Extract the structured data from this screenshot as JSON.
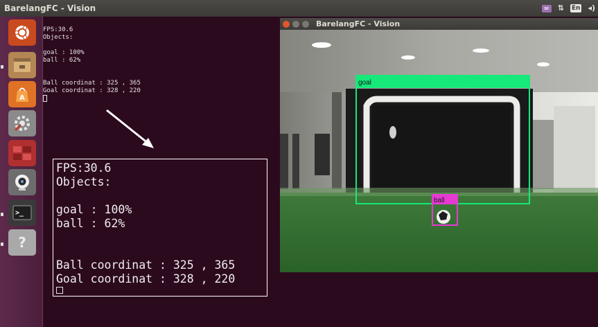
{
  "top_panel": {
    "title": "BarelangFC - Vision",
    "indicators": [
      {
        "icon": "mail-icon",
        "text": "✉"
      },
      {
        "icon": "network-icon",
        "text": "⇅"
      },
      {
        "icon": "keyboard-layout-icon",
        "text": "En"
      },
      {
        "icon": "volume-icon",
        "text": "◂)"
      }
    ]
  },
  "launcher": {
    "items": [
      {
        "name": "ubuntu-dash-icon",
        "color": "#c94a1e"
      },
      {
        "name": "files-icon",
        "color": "#b8905a"
      },
      {
        "name": "software-center-icon",
        "color": "#e07226"
      },
      {
        "name": "system-settings-icon",
        "color": "#8c8c8c"
      },
      {
        "name": "workspace-switcher-icon",
        "color": "#b03030"
      },
      {
        "name": "webcam-icon",
        "color": "#7a7a7a"
      },
      {
        "name": "terminal-icon",
        "color": "#3a3a3a"
      },
      {
        "name": "unknown-app-icon",
        "color": "#a9a9a9"
      }
    ]
  },
  "terminal": {
    "lines": [
      "FPS:30.6",
      "Objects:",
      "",
      "goal : 100%",
      "ball : 62%",
      "",
      "",
      "Ball coordinat : 325 , 365",
      "Goal coordinat : 328 , 220"
    ]
  },
  "callout": {
    "lines": [
      "FPS:30.6",
      "Objects:",
      "",
      "goal : 100%",
      "ball : 62%",
      "",
      "",
      "Ball coordinat : 325 , 365",
      "Goal coordinat : 328 , 220"
    ]
  },
  "vision_window": {
    "title": "BarelangFC - Vision",
    "detections": [
      {
        "label": "goal",
        "color": "#16e87a"
      },
      {
        "label": "ball",
        "color": "#e63ad2"
      }
    ]
  }
}
